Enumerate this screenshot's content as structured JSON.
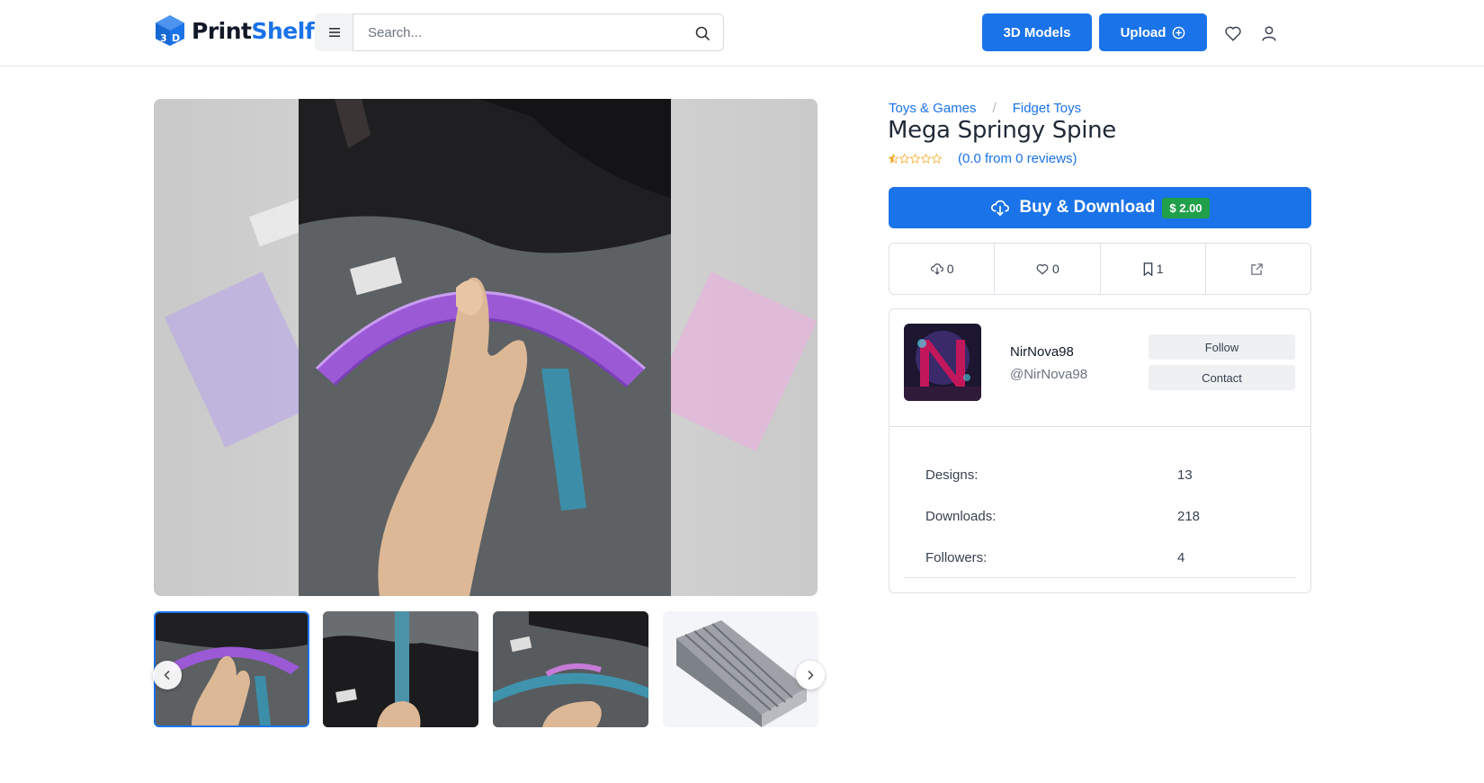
{
  "header": {
    "logo_left": "Print",
    "logo_right": "Shelf",
    "logo_cube_text": "3D",
    "menu_icon": "hamburger-icon",
    "search_placeholder": "Search...",
    "btn_models": "3D Models",
    "btn_upload": "Upload",
    "colors": {
      "brand": "#1a73e8",
      "text": "#111827"
    }
  },
  "product": {
    "breadcrumb": [
      "Toys & Games",
      "Fidget Toys"
    ],
    "breadcrumb_sep": "/",
    "title": "Mega Springy Spine",
    "rating_text": "(0.0 from 0 reviews)",
    "rating_value": 0.0,
    "stars_total": 5,
    "buy_label": "Buy & Download",
    "price": "$ 2.00",
    "stats": {
      "downloads": "0",
      "likes": "0",
      "collections": "1"
    },
    "colors": {
      "accent": "#1a73e8",
      "price_badge": "#20a04a"
    }
  },
  "creator": {
    "name": "NirNova98",
    "handle": "@NirNova98",
    "follow_label": "Follow",
    "contact_label": "Contact",
    "meta": [
      {
        "label": "Designs:",
        "value": "13"
      },
      {
        "label": "Downloads:",
        "value": "218"
      },
      {
        "label": "Followers:",
        "value": "4"
      }
    ]
  },
  "gallery": {
    "thumbnail_count": 4,
    "active_index": 0
  }
}
